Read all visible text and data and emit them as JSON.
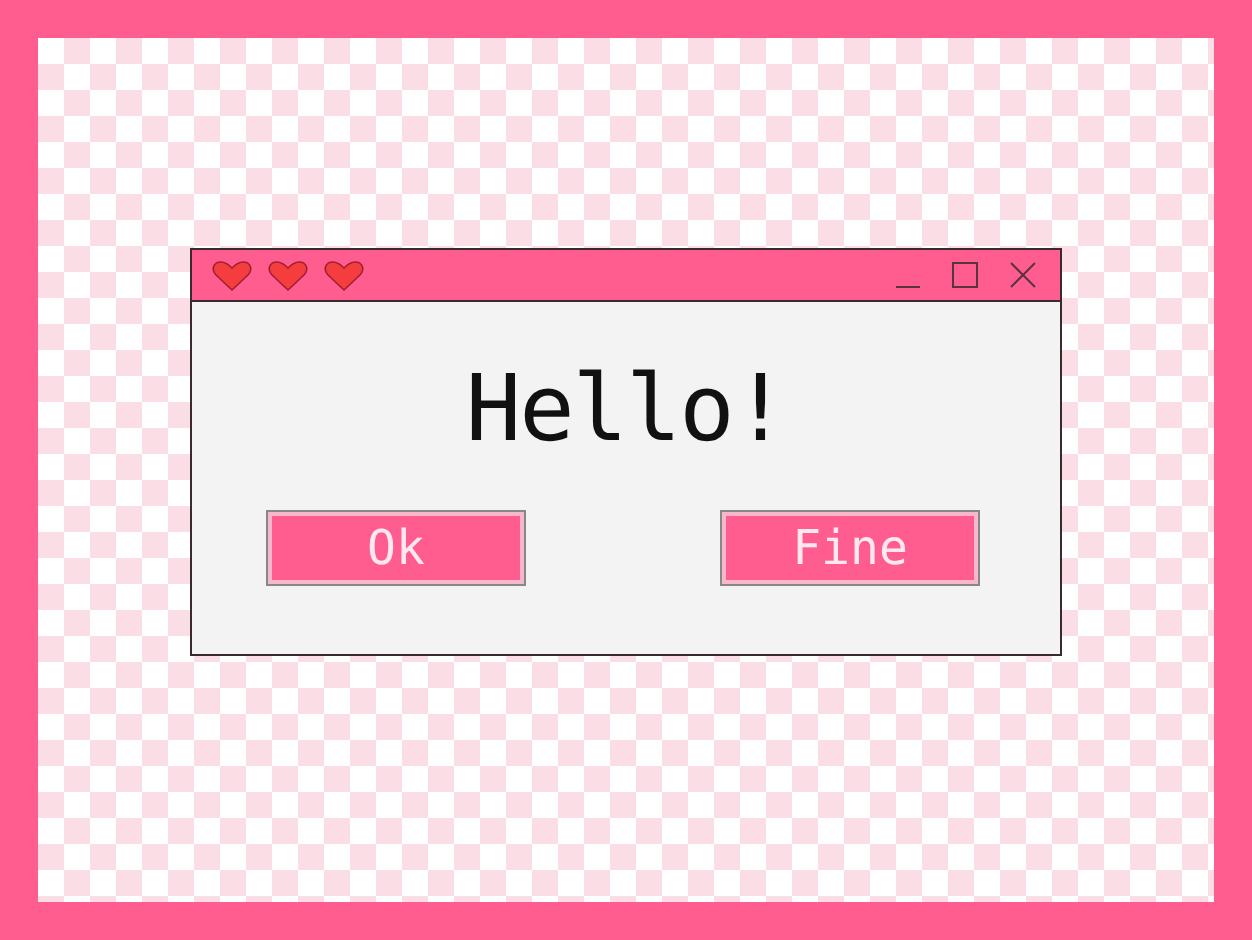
{
  "dialog": {
    "message": "Hello!",
    "buttons": [
      "Ok",
      "Fine"
    ]
  }
}
